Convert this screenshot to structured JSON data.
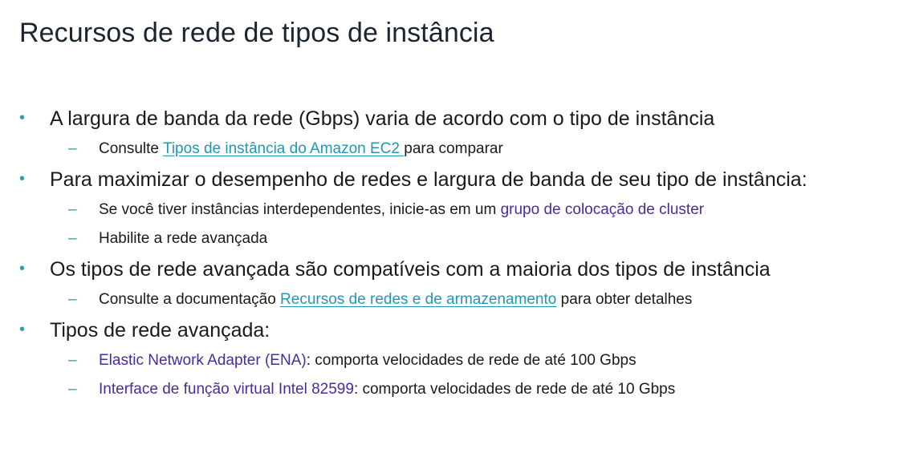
{
  "title": "Recursos de rede de tipos de instância",
  "items": [
    {
      "text": "A largura de banda da rede (Gbps) varia de acordo com o tipo de instância",
      "sub": [
        {
          "pre": "Consulte ",
          "link": "Tipos de instância do Amazon EC2 ",
          "post": "para comparar"
        }
      ]
    },
    {
      "text": "Para maximizar o desempenho de redes e largura de banda de seu tipo de instância:",
      "sub": [
        {
          "pre": "Se você tiver instâncias interdependentes, inicie-as em um ",
          "term": "grupo de colocação de cluster"
        },
        {
          "pre": "Habilite a rede avançada"
        }
      ]
    },
    {
      "text": "Os tipos de rede avançada são compatíveis com a maioria dos tipos de instância",
      "sub": [
        {
          "pre": "Consulte a documentação ",
          "link": "Recursos de redes e de armazenamento",
          "post": " para obter detalhes"
        }
      ]
    },
    {
      "text": "Tipos de rede avançada:",
      "sub": [
        {
          "term": "Elastic Network Adapter (ENA)",
          "post": ": comporta velocidades de rede de até 100 Gbps"
        },
        {
          "term": "Interface de função virtual Intel 82599",
          "post": ": comporta velocidades de rede de até 10 Gbps"
        }
      ]
    }
  ],
  "bullet_symbol": "•",
  "dash_symbol": "–",
  "colors": {
    "title": "#1b2532",
    "text": "#1a1a1a",
    "bullet": "#26a3a3",
    "link": "#1f97b5",
    "term": "#4a2b9c"
  }
}
